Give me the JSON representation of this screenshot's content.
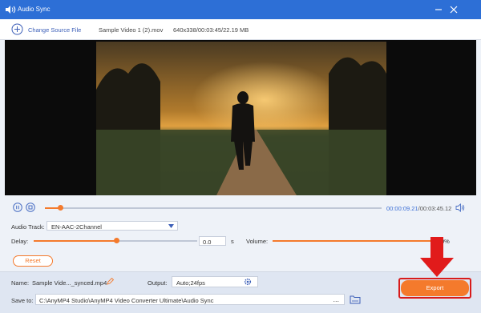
{
  "window": {
    "title": "Audio Sync"
  },
  "source": {
    "change_label": "Change Source File",
    "file_name": "Sample Video 1 (2).mov",
    "file_meta": "640x338/00:03:45/22.19 MB"
  },
  "player": {
    "current_time": "00:00:09.21",
    "total_time": "/00:03:45.12",
    "progress_fraction": 0.045
  },
  "audio": {
    "track_label": "Audio Track:",
    "track_value": "EN-AAC-2Channel",
    "delay_label": "Delay:",
    "delay_value": "0.0",
    "delay_unit": "s",
    "volume_label": "Volume:",
    "volume_suffix": "0%"
  },
  "reset_label": "Reset",
  "bottom": {
    "name_label": "Name:",
    "name_value": "Sample Vide..._synced.mp4",
    "output_label": "Output:",
    "output_value": "Auto;24fps",
    "save_label": "Save to:",
    "save_path": "C:\\AnyMP4 Studio\\AnyMP4 Video Converter Ultimate\\Audio Sync",
    "browse_label": "...",
    "export_label": "Export"
  },
  "colors": {
    "accent": "#f47a2c",
    "title_bar": "#2d6fd6",
    "highlight": "#d81b1b"
  }
}
